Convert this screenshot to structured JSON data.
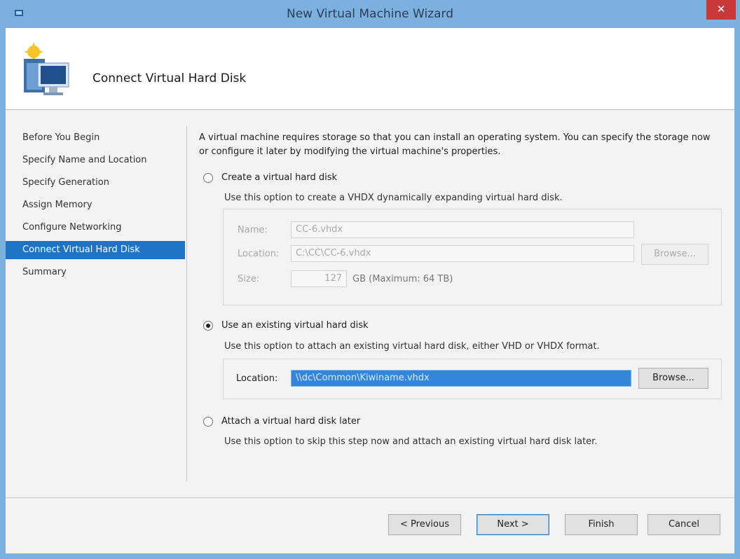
{
  "window": {
    "title": "New Virtual Machine Wizard",
    "close_glyph": "✕"
  },
  "header": {
    "title": "Connect Virtual Hard Disk",
    "icon": "virtual-machine-wizard-icon"
  },
  "nav": {
    "items": [
      {
        "label": "Before You Begin",
        "active": false
      },
      {
        "label": "Specify Name and Location",
        "active": false
      },
      {
        "label": "Specify Generation",
        "active": false
      },
      {
        "label": "Assign Memory",
        "active": false
      },
      {
        "label": "Configure Networking",
        "active": false
      },
      {
        "label": "Connect Virtual Hard Disk",
        "active": true
      },
      {
        "label": "Summary",
        "active": false
      }
    ]
  },
  "content": {
    "intro": "A virtual machine requires storage so that you can install an operating system. You can specify the storage now or configure it later by modifying the virtual machine's properties.",
    "create_option": {
      "label": "Create a virtual hard disk",
      "description": "Use this option to create a VHDX dynamically expanding virtual hard disk.",
      "checked": false,
      "name_label": "Name:",
      "name_value": "CC-6.vhdx",
      "location_label": "Location:",
      "location_value": "C:\\CC\\CC-6.vhdx",
      "browse_label": "Browse...",
      "size_label": "Size:",
      "size_value": "127",
      "size_unit": "GB (Maximum: 64 TB)"
    },
    "existing_option": {
      "label": "Use an existing virtual hard disk",
      "description": "Use this option to attach an existing virtual hard disk, either VHD or VHDX format.",
      "checked": true,
      "location_label": "Location:",
      "location_value": "\\\\dc\\Common\\Kiwiname.vhdx",
      "browse_label": "Browse..."
    },
    "later_option": {
      "label": "Attach a virtual hard disk later",
      "description": "Use this option to skip this step now and attach an existing virtual hard disk later.",
      "checked": false
    }
  },
  "footer": {
    "previous_label": "< Previous",
    "next_label": "Next >",
    "finish_label": "Finish",
    "cancel_label": "Cancel"
  },
  "colors": {
    "accent": "#1e73c7",
    "frame": "#7cb0de",
    "close_button": "#c8393a"
  }
}
